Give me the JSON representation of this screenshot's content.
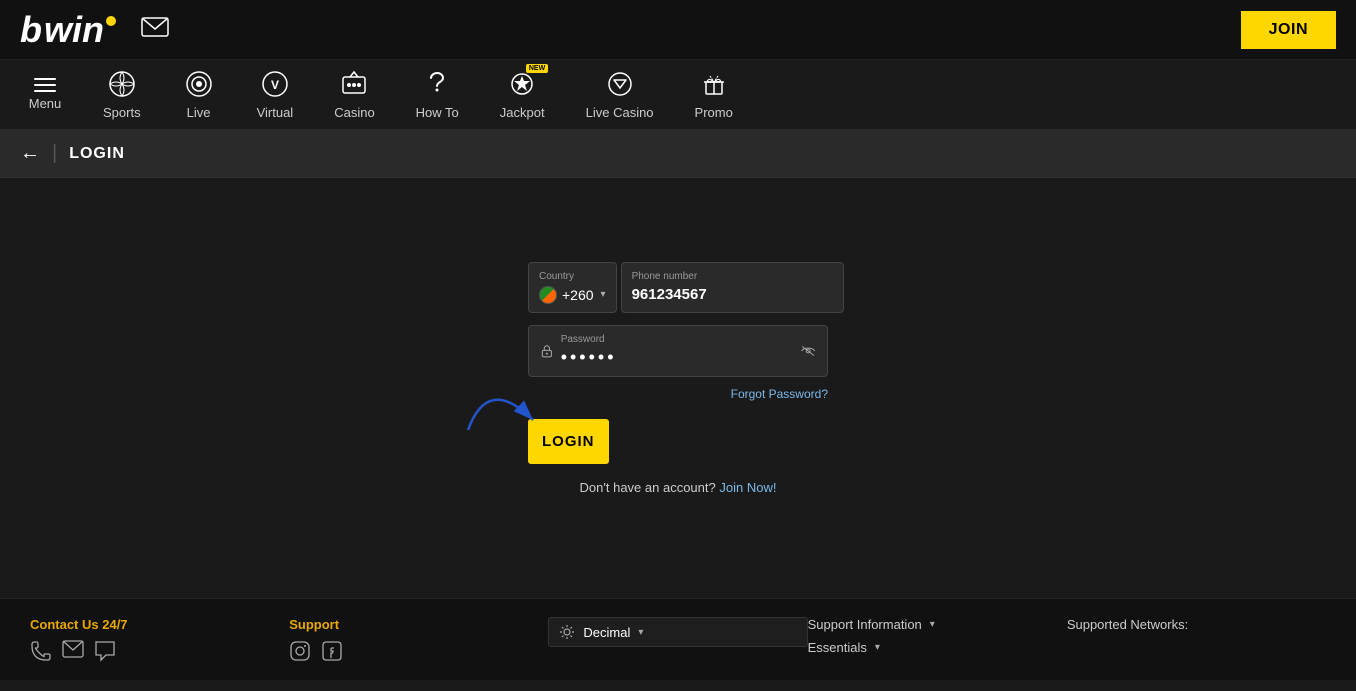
{
  "header": {
    "logo_text": "bwin",
    "join_label": "JOIN"
  },
  "nav": {
    "items": [
      {
        "id": "menu",
        "label": "Menu",
        "icon": "hamburger"
      },
      {
        "id": "sports",
        "label": "Sports",
        "icon": "sports"
      },
      {
        "id": "live",
        "label": "Live",
        "icon": "live"
      },
      {
        "id": "virtual",
        "label": "Virtual",
        "icon": "virtual"
      },
      {
        "id": "casino",
        "label": "Casino",
        "icon": "casino"
      },
      {
        "id": "how-to",
        "label": "How To",
        "icon": "howto"
      },
      {
        "id": "jackpot",
        "label": "Jackpot",
        "icon": "jackpot",
        "badge": "NEW"
      },
      {
        "id": "live-casino",
        "label": "Live Casino",
        "icon": "livecasino"
      },
      {
        "id": "promo",
        "label": "Promo",
        "icon": "promo"
      }
    ]
  },
  "page": {
    "back_label": "←",
    "title": "LOGIN"
  },
  "login_form": {
    "country_label": "Country",
    "country_code": "+260",
    "phone_label": "Phone number",
    "phone_value": "961234567",
    "password_label": "Password",
    "password_value": "••••••",
    "forgot_label": "Forgot Password?",
    "login_btn": "LOGIN",
    "signup_text": "Don't have an account?",
    "signup_link": "Join Now!"
  },
  "footer": {
    "contact_label": "Contact Us 24/7",
    "support_label": "Support",
    "decimal_label": "Decimal",
    "support_info_label": "Support Information",
    "essentials_label": "Essentials",
    "networks_label": "Supported Networks:"
  }
}
